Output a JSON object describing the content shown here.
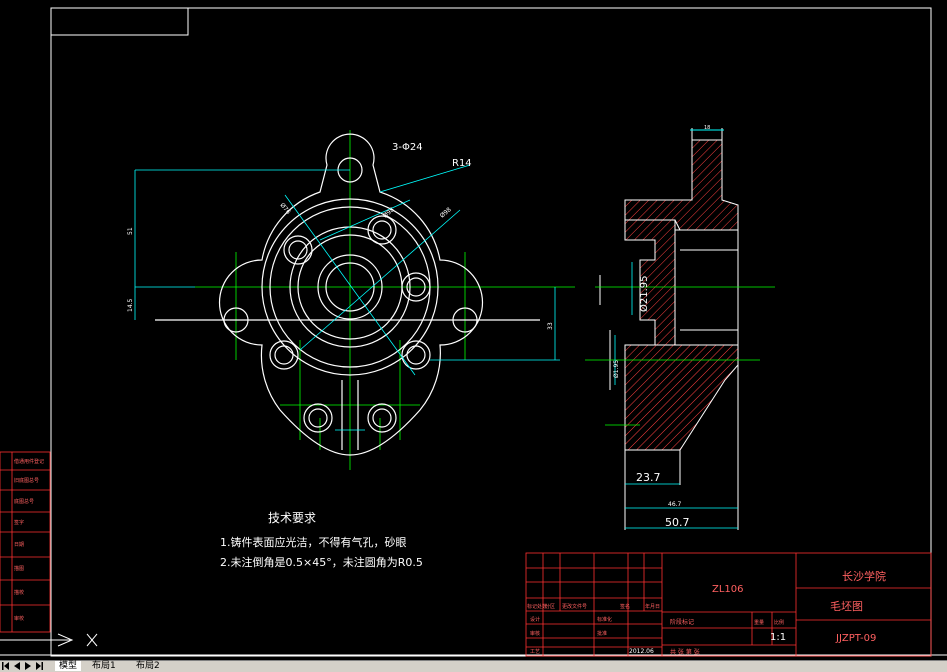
{
  "drawing": {
    "dims_front": {
      "holes_note": "3-Φ24",
      "radius": "R14",
      "d_a": "Ø76",
      "d_b": "Ø98",
      "d_c": "Ø98",
      "height_a": "51",
      "height_b": "14.5",
      "height_c": "33"
    },
    "dims_section": {
      "top_width": "18",
      "dia_a": "Ø21.95",
      "dia_b": "Ø1.95",
      "len_a": "23.7",
      "len_b": "46.7",
      "len_c": "50.7"
    },
    "tech": {
      "title": "技术要求",
      "line1": "1.铸件表面应光洁，不得有气孔，砂眼",
      "line2": "2.未注倒角是0.5×45°，未注圆角为R0.5"
    },
    "title_block": {
      "material": "ZL106",
      "school": "长沙学院",
      "part_name": "毛坯图",
      "drawing_no": "JJZPT-09",
      "scale": "1:1",
      "hdr_mark": "标记处数",
      "hdr_zone": "分区",
      "hdr_doc": "更改文件号",
      "hdr_sign": "签名",
      "hdr_date": "年月日",
      "design": "设计",
      "standard": "标准化",
      "check": "审核",
      "craft": "工艺",
      "approve": "批准",
      "date": "2012.06",
      "stage": "阶段标记",
      "weight": "重量",
      "ratio": "比例",
      "sheet": "共   张   第   张"
    },
    "left_strip": {
      "r1": "借通用件登记",
      "r2": "旧底图总号",
      "r3": "底图总号",
      "r4": "签字",
      "r5": "日期",
      "r6": "描图",
      "r7": "描校",
      "r8": "审校"
    }
  },
  "tabs": [
    "模型",
    "布局1",
    "布局2"
  ],
  "colors": {
    "white": "#ffffff",
    "green": "#00ff00",
    "cyan": "#00ffff",
    "red": "#ff3030",
    "hatch": "#ff4040"
  }
}
